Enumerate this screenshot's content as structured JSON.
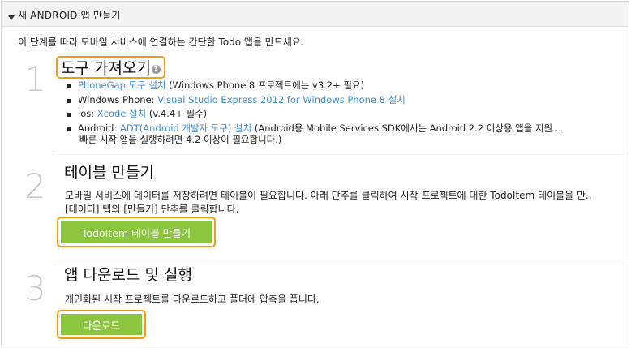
{
  "header": {
    "title": "새 ANDROID 앱 만들기"
  },
  "intro": "이 단계를 따라 모바일 서비스에 연결하는 간단한 Todo 앱을 만드세요.",
  "steps": [
    {
      "number": "1",
      "title": "도구 가져오기",
      "help_glyph": "?",
      "tools": [
        {
          "link": "PhoneGap 도구 설치",
          "text": " (Windows Phone 8 프로젝트에는 v3.2+ 필요)"
        },
        {
          "prefix": "Windows Phone: ",
          "link": "Visual Studio Express 2012 for Windows Phone 8 설치"
        },
        {
          "prefix": "ios: ",
          "link": "Xcode 설치",
          "text": " (v.4.4+ 필수)"
        },
        {
          "prefix": "Android: ",
          "link": "ADT(Android 개발자 도구) 설치",
          "text": "  (Android용 Mobile Services SDK에서는 Android 2.2 이상용 앱을 지원..."
        }
      ],
      "continuation": "빠른 시작 앱을 실행하려면 4.2 이상이 필요합니다.)"
    },
    {
      "number": "2",
      "title": "테이블 만들기",
      "desc_line1": "모바일 서비스에 데이터를 저장하려면 테이블이 필요합니다. 아래 단추를 클릭하여 시작 프로젝트에 대한 TodoItem 테이블을 만..",
      "desc_line2": "[데이터] 탭의 [만들기] 단추를 클릭합니다.",
      "button": "TodoItem 테이블 만들기"
    },
    {
      "number": "3",
      "title": "앱 다운로드 및 실행",
      "desc_line1": "개인화된 시작 프로젝트를 다운로드하고 폴더에 압축을 풉니다.",
      "button": "다운로드"
    }
  ],
  "colors": {
    "accent_green": "#8cc63f",
    "highlight_orange": "#f39c12",
    "link_blue": "#3d8ed6"
  }
}
